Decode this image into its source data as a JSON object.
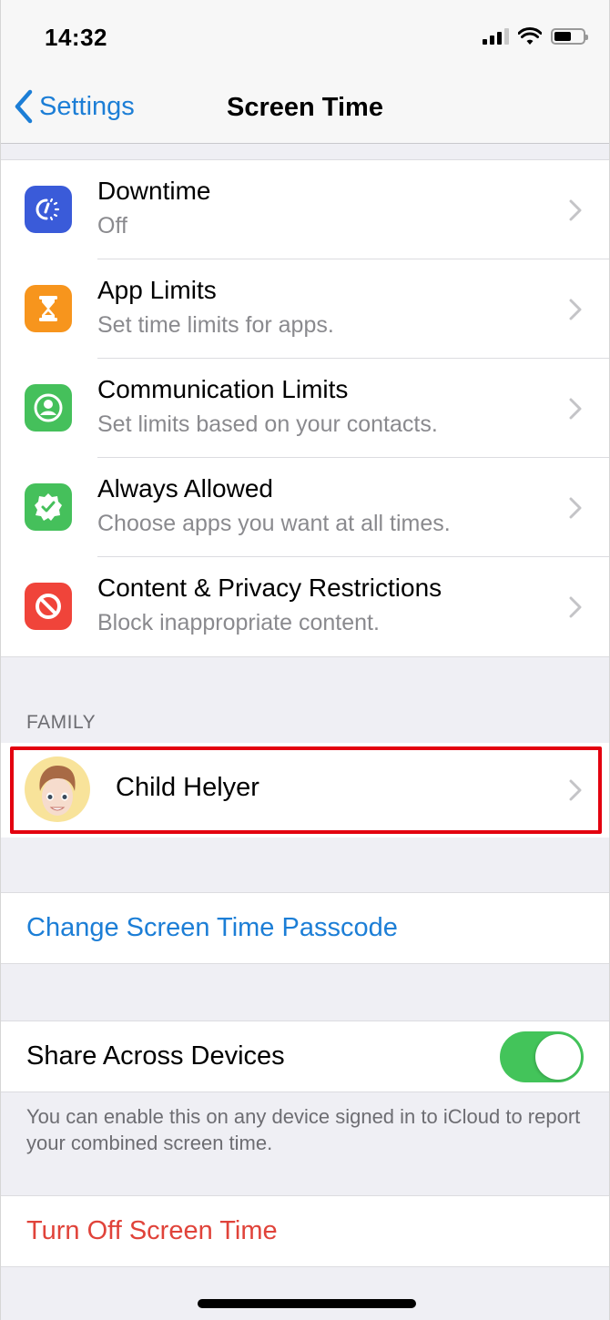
{
  "status_bar": {
    "time": "14:32",
    "icons": [
      "cellular-signal-icon",
      "wifi-icon",
      "battery-icon"
    ]
  },
  "nav": {
    "back_label": "Settings",
    "title": "Screen Time"
  },
  "settings": {
    "items": [
      {
        "title": "Downtime",
        "subtitle": "Off",
        "icon": "downtime-icon",
        "color": "#3a5bd9"
      },
      {
        "title": "App Limits",
        "subtitle": "Set time limits for apps.",
        "icon": "hourglass-icon",
        "color": "#f7951d"
      },
      {
        "title": "Communication Limits",
        "subtitle": "Set limits based on your contacts.",
        "icon": "contact-icon",
        "color": "#45c05b"
      },
      {
        "title": "Always Allowed",
        "subtitle": "Choose apps you want at all times.",
        "icon": "checkmark-badge-icon",
        "color": "#45c05b"
      },
      {
        "title": "Content & Privacy Restrictions",
        "subtitle": "Block inappropriate content.",
        "icon": "prohibited-icon",
        "color": "#f0443a"
      }
    ]
  },
  "family": {
    "header": "FAMILY",
    "member_name": "Child Helyer"
  },
  "passcode": {
    "label": "Change Screen Time Passcode"
  },
  "share": {
    "label": "Share Across Devices",
    "enabled": true,
    "footer": "You can enable this on any device signed in to iCloud to report your combined screen time."
  },
  "turn_off": {
    "label": "Turn Off Screen Time"
  },
  "colors": {
    "accent_blue": "#1c7ed6",
    "destructive_red": "#e0433a",
    "toggle_green": "#43c45a",
    "highlight_red": "#e3000f"
  }
}
